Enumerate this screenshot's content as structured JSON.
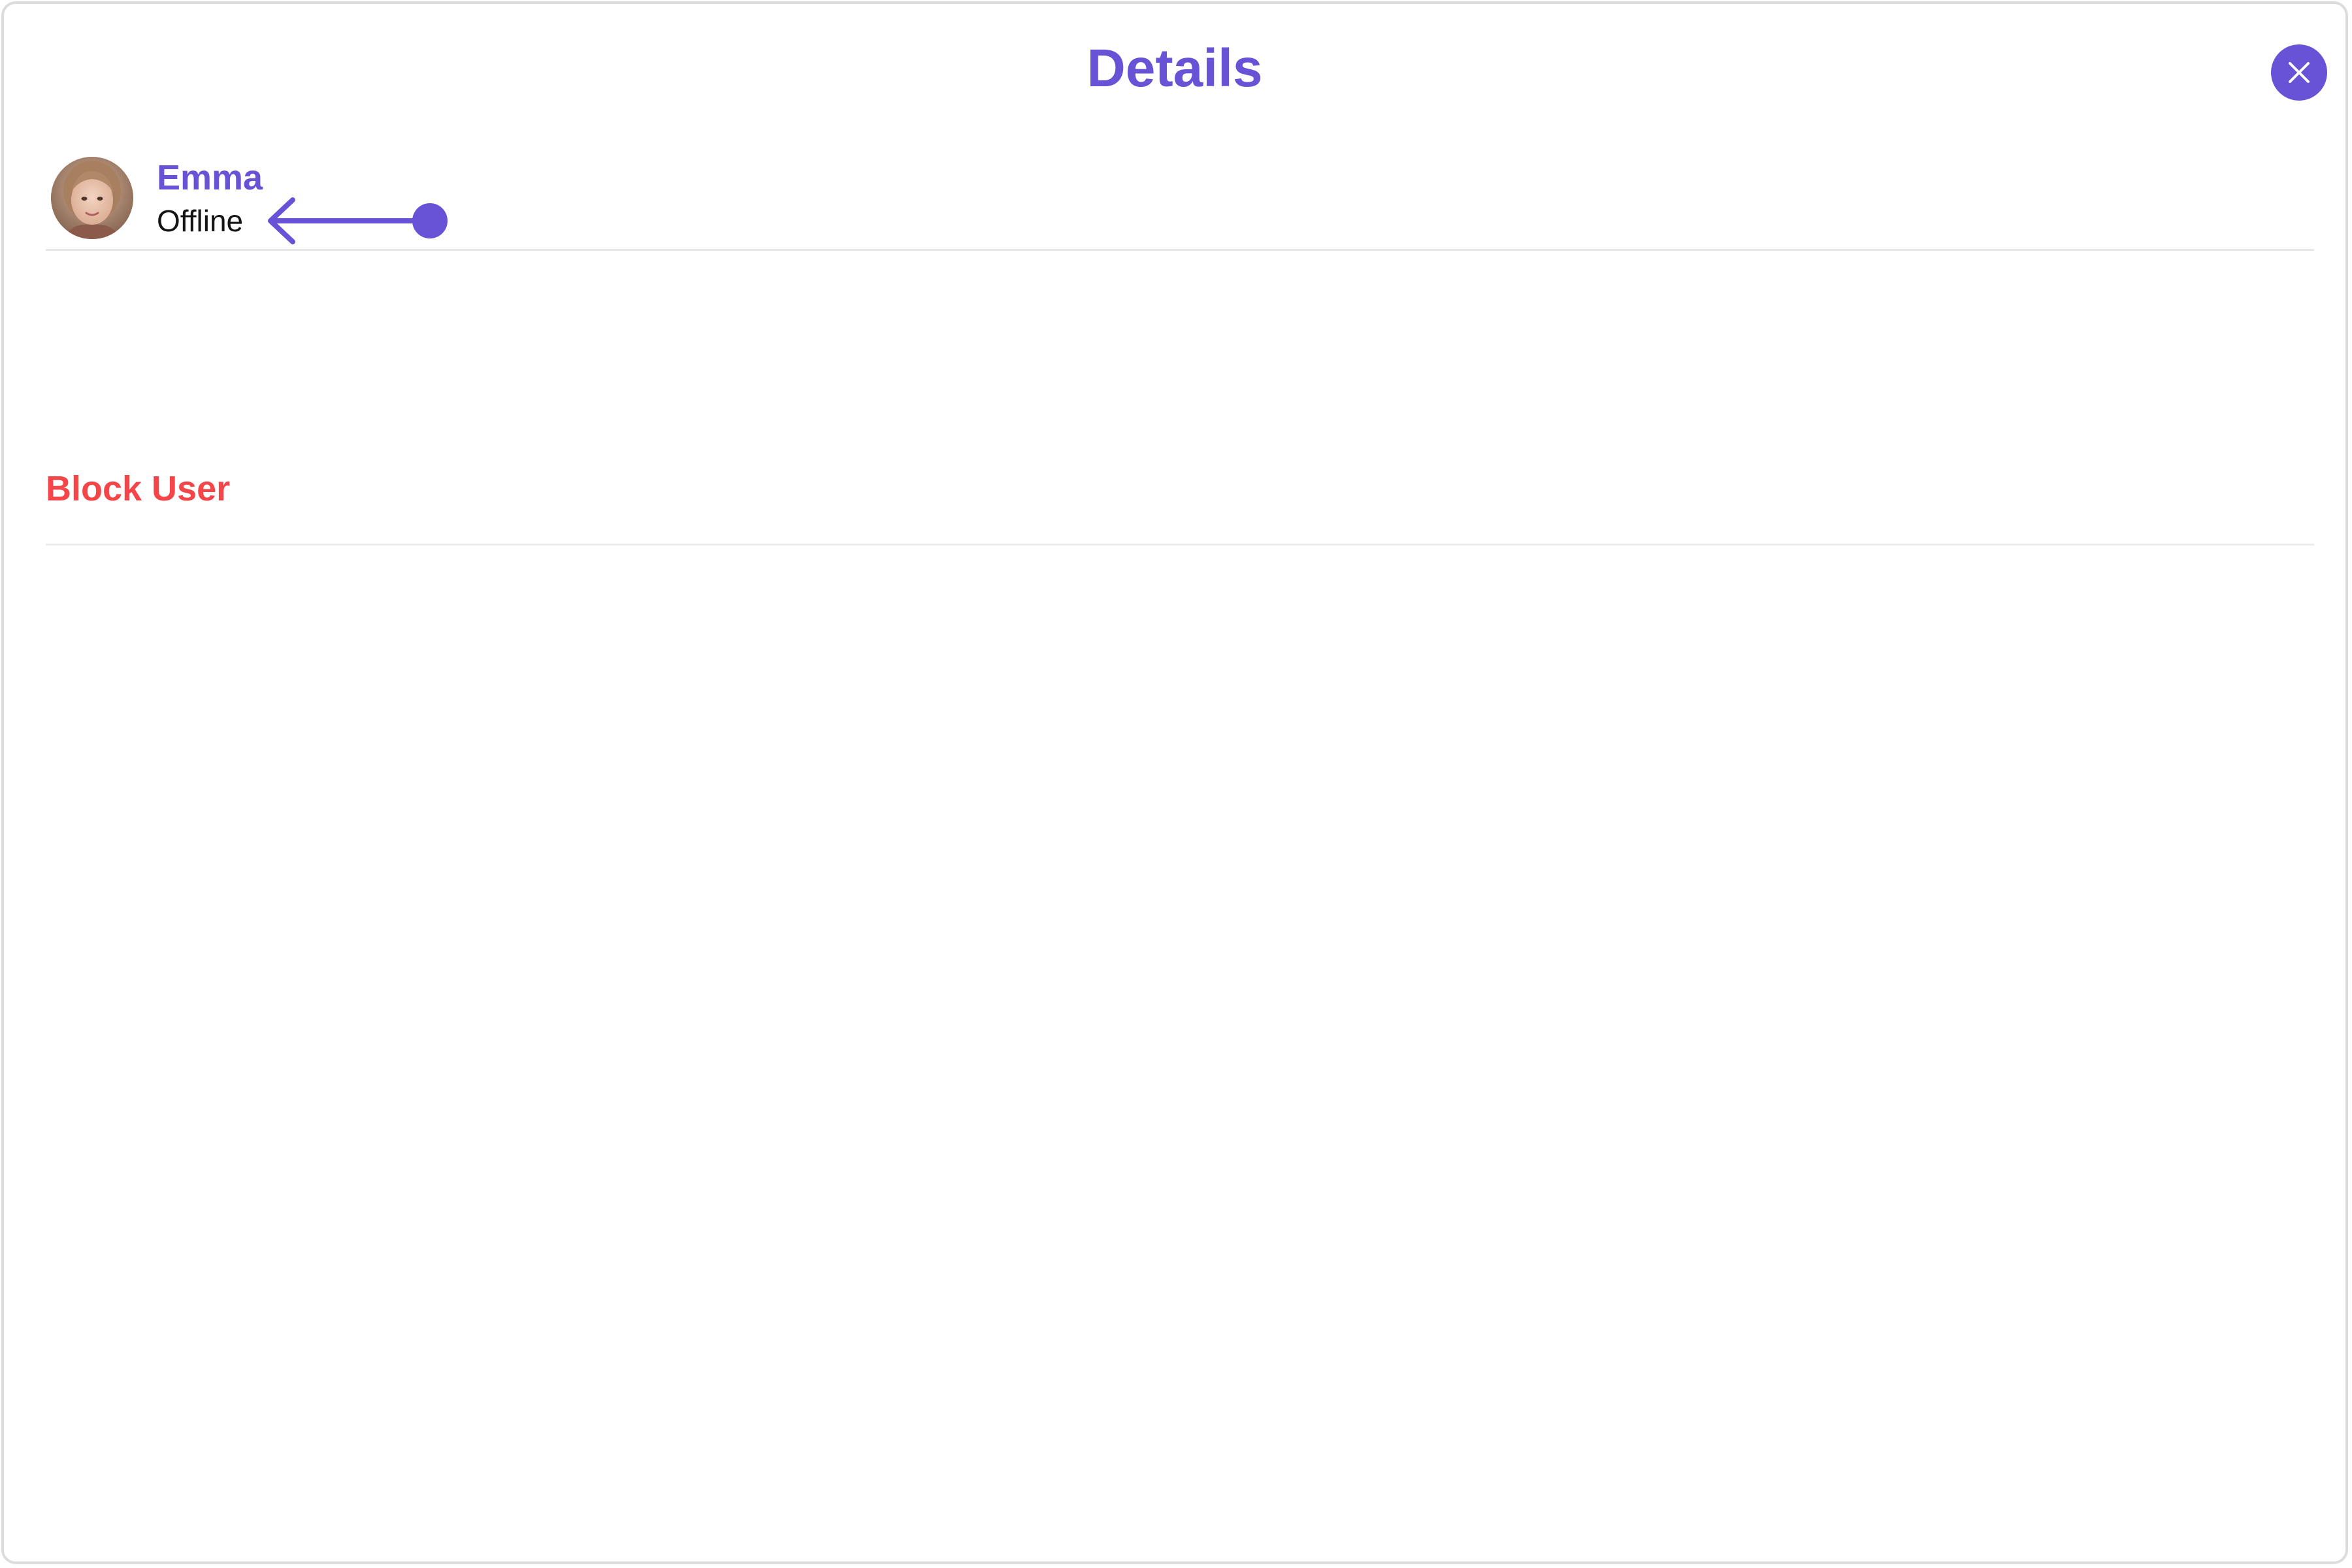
{
  "header": {
    "title": "Details"
  },
  "user": {
    "name": "Emma",
    "status": "Offline"
  },
  "actions": {
    "block_label": "Block User"
  },
  "colors": {
    "accent": "#6852d6",
    "danger": "#f44649",
    "divider": "#e6e6e6",
    "text": "#141414"
  },
  "icons": {
    "close": "close-icon",
    "pointer": "arrow-left-pointer-icon"
  }
}
